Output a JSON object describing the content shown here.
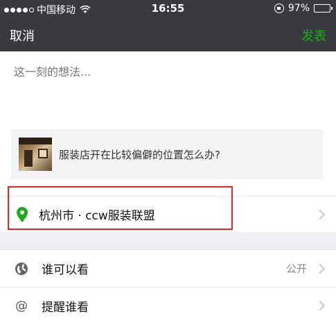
{
  "status_bar": {
    "carrier": "中国移动",
    "time": "16:55",
    "battery": "97%",
    "battery_level": 0.97
  },
  "nav": {
    "cancel_label": "取消",
    "publish_label": "发表"
  },
  "composer": {
    "placeholder": "这一刻的想法..."
  },
  "share_card": {
    "title": "服装店开在比较偏僻的位置怎么办?"
  },
  "location": {
    "text": "杭州市 · ccw服装联盟"
  },
  "settings": {
    "items": [
      {
        "icon": "globe-icon",
        "label": "谁可以看",
        "value": "公开"
      },
      {
        "icon": "at-icon",
        "label": "提醒谁看",
        "value": ""
      }
    ]
  },
  "colors": {
    "bar_bg": "#393a3f",
    "accent_green": "#1aad19",
    "highlight_red": "#e42525"
  }
}
